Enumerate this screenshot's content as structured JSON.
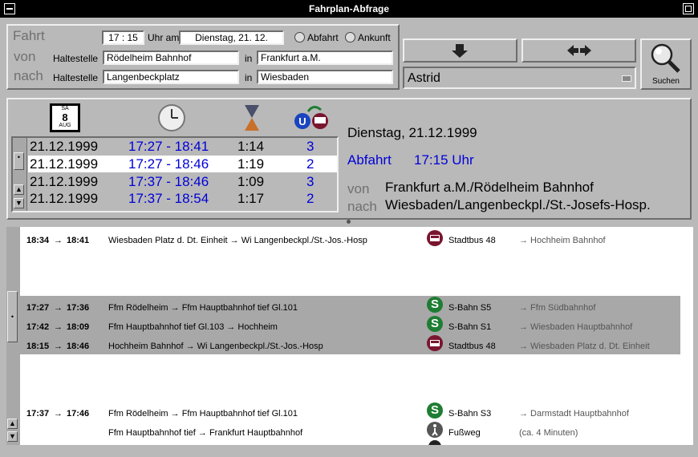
{
  "window": {
    "title": "Fahrplan-Abfrage"
  },
  "query": {
    "fahrt_label": "Fahrt",
    "von_label": "von",
    "nach_label": "nach",
    "time_value": "17 : 15",
    "uhr_am": "Uhr am",
    "date_value": "Dienstag, 21. 12.",
    "abfahrt_label": "Abfahrt",
    "ankunft_label": "Ankunft",
    "haltestelle": "Haltestelle",
    "in": "in",
    "from_stop": "Rödelheim Bahnhof",
    "from_city": "Frankfurt a.M.",
    "to_stop": "Langenbeckplatz",
    "to_city": "Wiesbaden"
  },
  "controls": {
    "profile": "Astrid",
    "search_label": "Suchen"
  },
  "calendar_icon": {
    "weekday": "SA",
    "day": "8",
    "month": "AUG"
  },
  "results": [
    {
      "date": "21.12.1999",
      "time": "17:27 - 18:41",
      "duration": "1:14",
      "changes": "3"
    },
    {
      "date": "21.12.1999",
      "time": "17:27 - 18:46",
      "duration": "1:19",
      "changes": "2"
    },
    {
      "date": "21.12.1999",
      "time": "17:37 - 18:46",
      "duration": "1:09",
      "changes": "3"
    },
    {
      "date": "21.12.1999",
      "time": "17:37 - 18:54",
      "duration": "1:17",
      "changes": "2"
    }
  ],
  "summary": {
    "day": "Dienstag, 21.12.1999",
    "mode": "Abfahrt",
    "time": "17:15 Uhr",
    "von_label": "von",
    "nach_label": "nach",
    "from": "Frankfurt a.M./Rödelheim Bahnhof",
    "to": "Wiesbaden/Langenbeckpl./St.-Josefs-Hosp."
  },
  "details": [
    {
      "dep": "18:34",
      "arr": "18:41",
      "route": "Wiesbaden Platz d. Dt. Einheit → Wi Langenbeckpl./St.-Jos.-Hosp",
      "icon": "bus-icon",
      "line": "Stadtbus 48",
      "dir": "→ Hochheim Bahnhof"
    },
    {
      "dep": "17:27",
      "arr": "17:36",
      "route": "Ffm Rödelheim → Ffm Hauptbahnhof tief Gl.101",
      "icon": "sbahn-icon",
      "line": "S-Bahn S5",
      "dir": "→ Ffm Südbahnhof"
    },
    {
      "dep": "17:42",
      "arr": "18:09",
      "route": "Ffm Hauptbahnhof tief Gl.103 → Hochheim",
      "icon": "sbahn-icon",
      "line": "S-Bahn S1",
      "dir": "→ Wiesbaden Hauptbahnhof"
    },
    {
      "dep": "18:15",
      "arr": "18:46",
      "route": "Hochheim Bahnhof → Wi Langenbeckpl./St.-Jos.-Hosp",
      "icon": "bus-icon",
      "line": "Stadtbus 48",
      "dir": "→ Wiesbaden Platz d. Dt. Einheit"
    },
    {
      "dep": "17:37",
      "arr": "17:46",
      "route": "Ffm Rödelheim → Ffm Hauptbahnhof tief Gl.101",
      "icon": "sbahn-icon",
      "line": "S-Bahn S3",
      "dir": "→ Darmstadt Hauptbahnhof"
    },
    {
      "dep": "",
      "arr": "",
      "route": "Ffm Hauptbahnhof tief → Frankfurt Hauptbahnhof",
      "icon": "walk-icon",
      "line": "Fußweg",
      "dir": "(ca. 4 Minuten)"
    }
  ],
  "arrow_glyph": "→",
  "icon_glyphs": {
    "sbahn": "S"
  },
  "colors": {
    "blue": "#0000d8",
    "sbahn": "#1e7d32",
    "bus": "#7a1530"
  }
}
